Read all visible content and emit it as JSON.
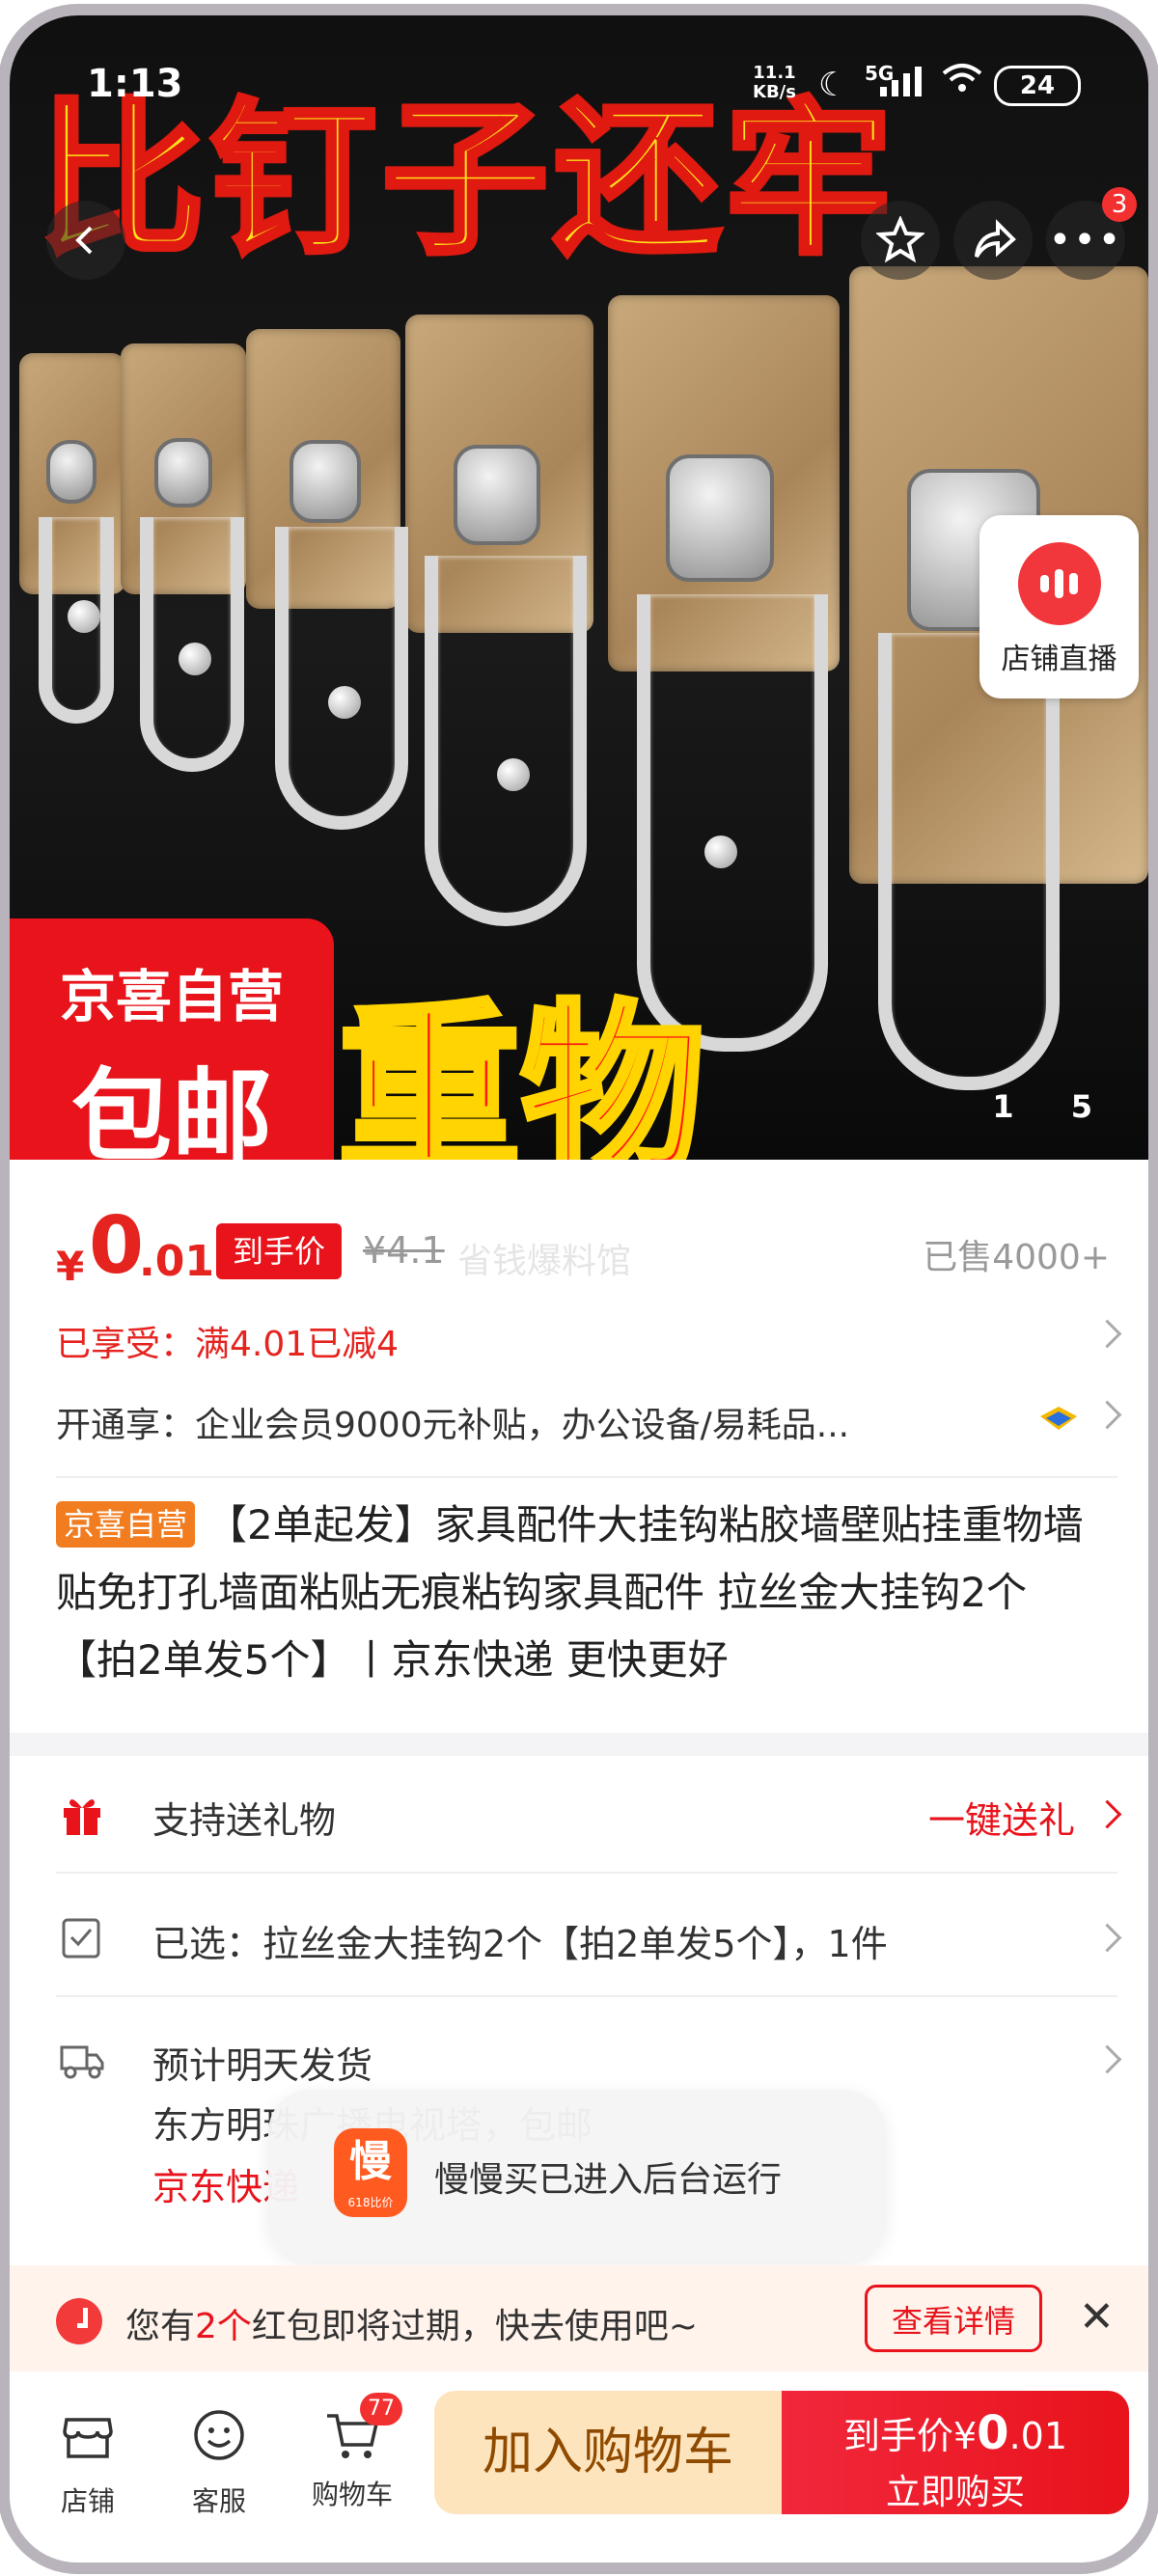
{
  "status_bar": {
    "time": "1:13",
    "net_speed": "11.1",
    "net_unit": "KB/s",
    "signal": "5G",
    "battery": "24"
  },
  "nav": {
    "more_badge": "3"
  },
  "hero": {
    "headline": "比钉子还牢",
    "badge_line1": "京喜自营",
    "badge_line2": "包邮",
    "heavy_text": "重物",
    "page_current": "1",
    "page_total": "5",
    "live_label": "店铺直播"
  },
  "price": {
    "currency": "¥",
    "integer": "0",
    "decimal": ".01",
    "tag": "到手价",
    "original": "¥4.1",
    "shop_watermark": "省钱爆料馆",
    "sold": "已售4000+"
  },
  "promo": {
    "enjoyed": "已享受：满4.01已减4",
    "membership": "开通享：企业会员9000元补贴，办公设备/易耗品..."
  },
  "product": {
    "tag": "京喜自营",
    "title": "【2单起发】家具配件大挂钩粘胶墙壁贴挂重物墙贴免打孔墙面粘贴无痕粘钩家具配件 拉丝金大挂钩2个【拍2单发5个】丨京东快递 更快更好"
  },
  "options": {
    "gift_label": "支持送礼物",
    "gift_action": "一键送礼",
    "selected": "已选：拉丝金大挂钩2个【拍2单发5个】，1件",
    "ship_label": "预计明天发货",
    "ship_address": "东方明珠广播电视塔，包邮",
    "ship_carrier": "京东快递"
  },
  "toast": {
    "logo_text": "慢",
    "logo_sub": "618比价",
    "message": "慢慢买已进入后台运行"
  },
  "coupon": {
    "pre": "您有",
    "count": "2个",
    "post": "红包即将过期，快去使用吧~",
    "button": "查看详情"
  },
  "bottom": {
    "shop": "店铺",
    "service": "客服",
    "cart": "购物车",
    "cart_badge": "77",
    "add_cart": "加入购物车",
    "buy_price_label": "到手价",
    "buy_currency": "¥",
    "buy_price_int": "0",
    "buy_price_dec": ".01",
    "buy_now": "立即购买"
  },
  "colors": {
    "accent": "#e8131b",
    "hero_text": "#ffe11a",
    "add_cart_bg": "#fde4bd"
  }
}
